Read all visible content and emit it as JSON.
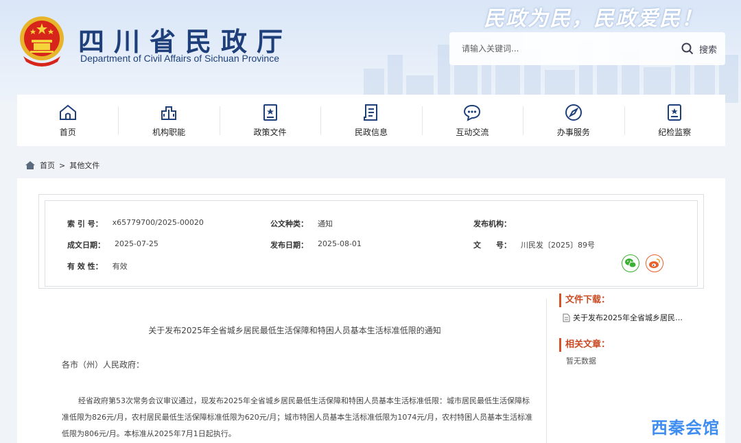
{
  "header": {
    "title": "四川省民政厅",
    "subtitle": "Department of Civil Affairs of Sichuan Province",
    "slogan": "民政为民，民政爱民！",
    "search": {
      "placeholder": "请输入关键词...",
      "button_label": "搜索"
    }
  },
  "nav": {
    "items": [
      {
        "label": "首页",
        "icon": "home-icon"
      },
      {
        "label": "机构职能",
        "icon": "building-icon"
      },
      {
        "label": "政策文件",
        "icon": "document-star-icon"
      },
      {
        "label": "民政信息",
        "icon": "news-icon"
      },
      {
        "label": "互动交流",
        "icon": "chat-icon"
      },
      {
        "label": "办事服务",
        "icon": "compass-icon"
      },
      {
        "label": "纪检监察",
        "icon": "badge-icon"
      }
    ]
  },
  "breadcrumb": {
    "home": "首页",
    "separator": ">",
    "current": "其他文件"
  },
  "meta": {
    "index_label": "索 引 号：",
    "index_value": "x65779700/2025-00020",
    "type_label": "公文种类：",
    "type_value": "通知",
    "issuer_label": "发布机构：",
    "issuer_value": "",
    "created_label": "成文日期：",
    "created_value": "2025-07-25",
    "published_label": "发布日期：",
    "published_value": "2025-08-01",
    "docno_label": "文　　号：",
    "docno_value": "川民发〔2025〕89号",
    "validity_label": "有 效 性：",
    "validity_value": "有效"
  },
  "article": {
    "title": "关于发布2025年全省城乡居民最低生活保障和特困人员基本生活标准低限的通知",
    "salutation": "各市（州）人民政府：",
    "body": "经省政府第53次常务会议审议通过，现发布2025年全省城乡居民最低生活保障和特困人员基本生活标准低限：城市居民最低生活保障标准低限为826元/月，农村居民最低生活保障标准低限为620元/月；城市特困人员基本生活标准低限为1074元/月，农村特困人员基本生活标准低限为806元/月。本标准从2025年7月1日起执行。"
  },
  "sidebar": {
    "downloads_title": "文件下载：",
    "download_link": "关于发布2025年全省城乡居民…",
    "related_title": "相关文章：",
    "related_empty": "暂无数据"
  },
  "watermark": "西秦会馆",
  "colors": {
    "brand_blue": "#1e3f7a",
    "accent_orange": "#d4532a",
    "wechat_green": "#3cb035",
    "weibo_orange": "#e8612c"
  }
}
